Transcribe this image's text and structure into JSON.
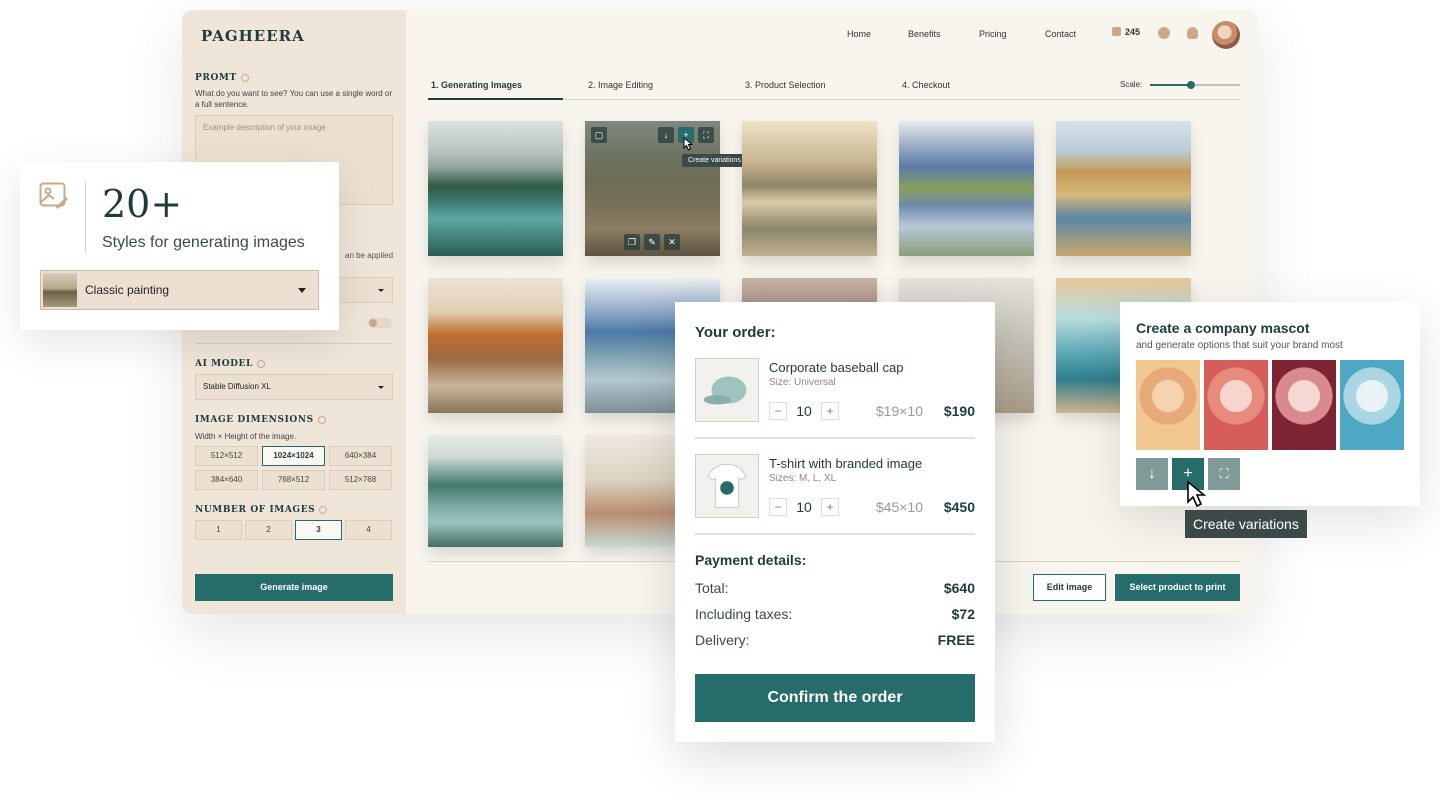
{
  "app": {
    "logo": "PAGHEERA",
    "nav": [
      "Home",
      "Benefits",
      "Pricing",
      "Contact"
    ],
    "credits": "245"
  },
  "sidebar": {
    "prompt_title": "PROMT",
    "prompt_desc": "What do you want to see? You can use a single word or a full sentence.",
    "prompt_placeholder": "Example description of your image",
    "partial_text": "an be applied",
    "ai_model_title": "AI MODEL",
    "ai_model_value": "Stable Diffusion XL",
    "dimensions_title": "IMAGE DIMENSIONS",
    "dimensions_desc": "Width × Height of the image.",
    "dimensions": [
      "512×512",
      "1024×1024",
      "640×384",
      "384×640",
      "768×512",
      "512×768"
    ],
    "dimensions_selected": "1024×1024",
    "number_title": "NUMBER OF IMAGES",
    "numbers": [
      "1",
      "2",
      "3",
      "4"
    ],
    "number_selected": "3",
    "generate_label": "Generate image"
  },
  "steps": [
    "1. Generating Images",
    "2. Image Editing",
    "3. Product Selection",
    "4. Checkout"
  ],
  "scale": {
    "label": "Scale:",
    "value": 0.45
  },
  "tile_tooltip": "Create variations",
  "actions": {
    "edit_label": "Edit image",
    "select_label": "Select product to print"
  },
  "styles_card": {
    "count": "20+",
    "caption": "Styles for generating images",
    "selected_style": "Classic painting"
  },
  "order": {
    "title": "Your order:",
    "items": [
      {
        "name": "Corporate baseball cap",
        "size": "Size: Universal",
        "qty": "10",
        "calc": "$19×10",
        "total": "$190"
      },
      {
        "name": "T-shirt with branded image",
        "size": "Sizes: M, L, XL",
        "qty": "10",
        "calc": "$45×10",
        "total": "$450"
      }
    ],
    "minus": "−",
    "plus": "+",
    "payment_title": "Payment details:",
    "payment": [
      {
        "label": "Total:",
        "value": "$640"
      },
      {
        "label": "Including taxes:",
        "value": "$72"
      },
      {
        "label": "Delivery:",
        "value": "FREE"
      }
    ],
    "confirm_label": "Confirm the order"
  },
  "mascot_card": {
    "title": "Create a company mascot",
    "subtitle": "and generate options that suit your brand most",
    "tooltip": "Create variations"
  },
  "colors": {
    "accent": "#256c6a",
    "sidebar": "#efe5d8",
    "background": "#f8f4ee"
  },
  "icons": [
    "info-icon",
    "bell-icon",
    "coin-icon",
    "download-icon",
    "plus-icon",
    "expand-icon",
    "select-icon",
    "trash-icon",
    "copy-icon",
    "image-edit-icon"
  ]
}
